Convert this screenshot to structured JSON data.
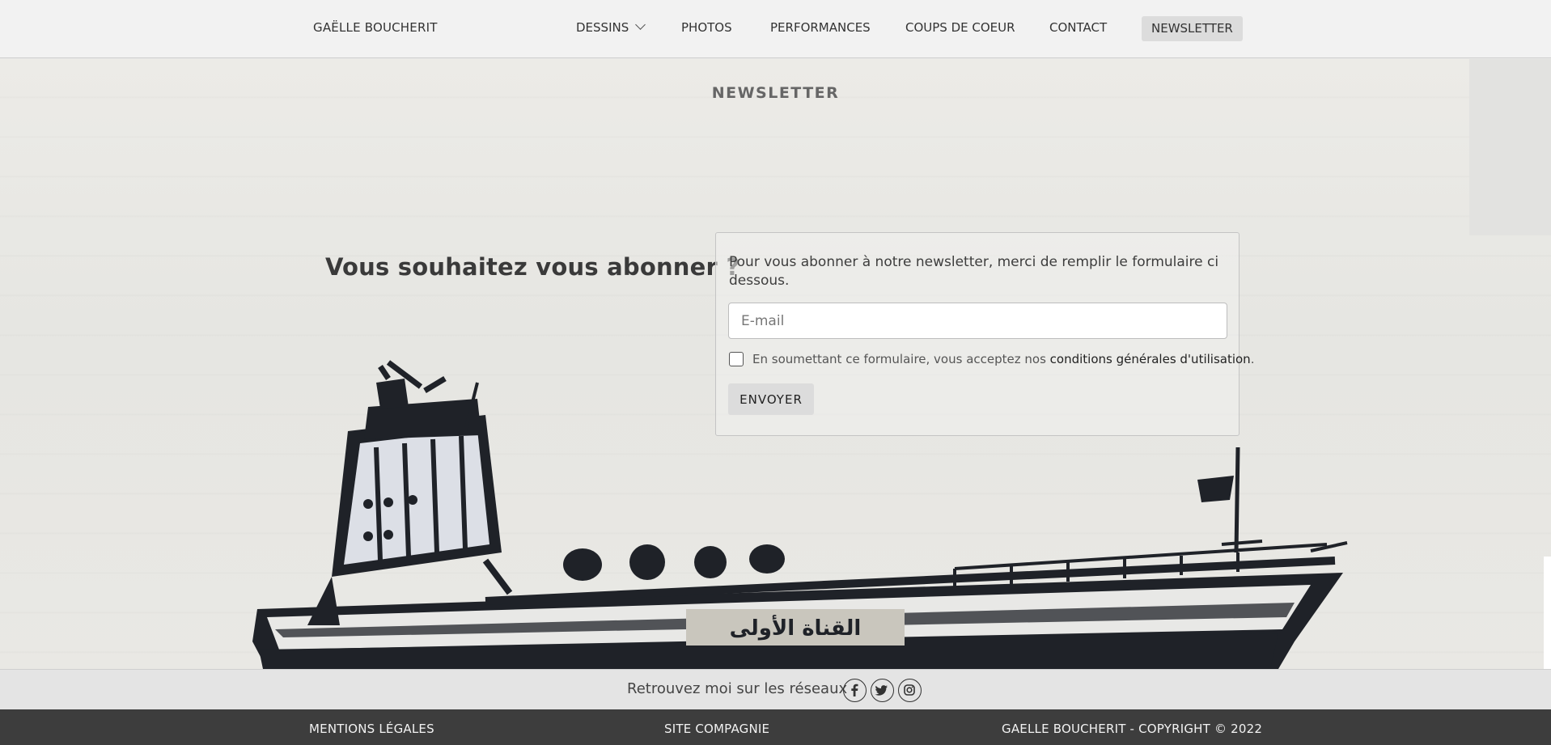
{
  "header": {
    "brand": "GAËLLE BOUCHERIT",
    "nav": {
      "dessins": "DESSINS",
      "photos": "PHOTOS",
      "performances": "PERFORMANCES",
      "coups_de_coeur": "COUPS DE COEUR",
      "contact": "CONTACT",
      "newsletter": "NEWSLETTER"
    },
    "active_item": "NEWSLETTER"
  },
  "page": {
    "title": "NEWSLETTER",
    "question": "Vous souhaitez vous abonner ?"
  },
  "form": {
    "intro": "Pour vous abonner à notre newsletter, merci de remplir le formulaire ci dessous.",
    "email_placeholder": "E-mail",
    "email_value": "",
    "terms_prefix": "En soumettant ce formulaire, vous acceptez nos ",
    "terms_link": "conditions générales d'utilisation",
    "terms_suffix": ".",
    "checkbox_checked": false,
    "submit_label": "ENVOYER"
  },
  "social": {
    "text": "Retrouvez moi sur les réseaux",
    "icons": [
      "facebook-icon",
      "twitter-icon",
      "instagram-icon"
    ]
  },
  "footer": {
    "legal": "MENTIONS LÉGALES",
    "company": "SITE COMPAGNIE",
    "copyright": "GAELLE BOUCHERIT - COPYRIGHT © 2022"
  },
  "background": {
    "ship_label": "القناة الأولى"
  },
  "colors": {
    "header_bg": "#f2f2f2",
    "active_bg": "#dcdcdc",
    "footer_bg": "#3d3d3d",
    "social_bg": "#e4e4e4"
  }
}
